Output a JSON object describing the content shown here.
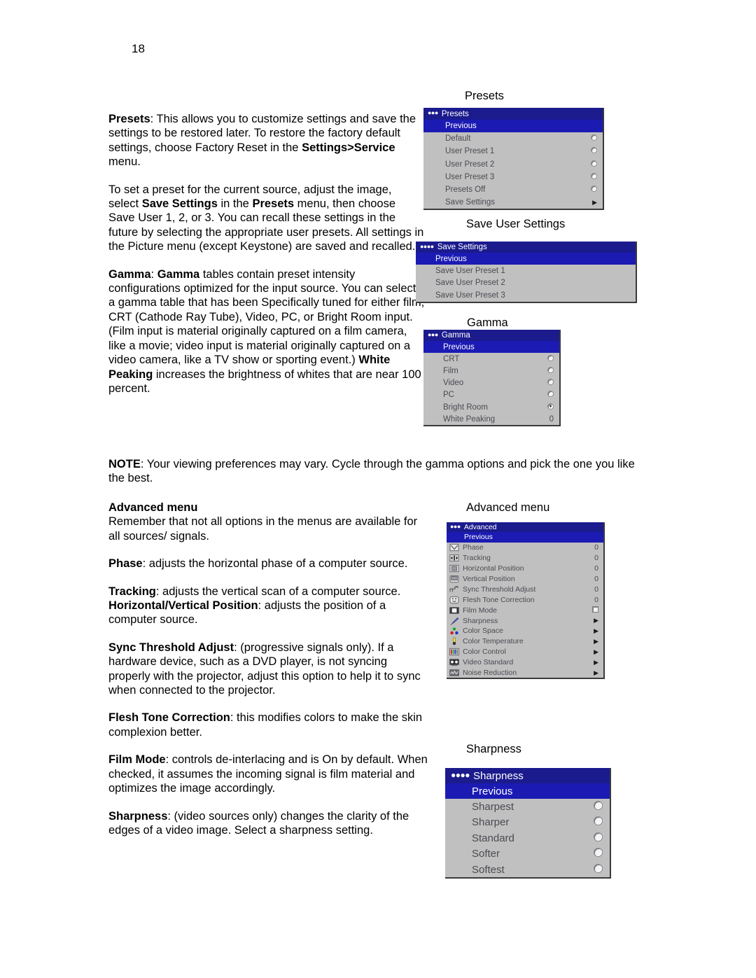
{
  "page": {
    "number": "18"
  },
  "body": {
    "p_presets": "Presets: This allows you to customize settings and save the settings to be restored later. To restore the factory default settings, choose Factory Reset in the Settings>Service menu.",
    "p_preset_howto": "To set a preset for the current source, adjust the image, select Save Settings in the Presets menu, then choose Save User 1, 2, or 3. You can recall these settings in the future by selecting the appropriate user presets. All settings in the Picture menu (except Keystone) are saved and recalled.",
    "p_gamma": "Gamma: Gamma tables contain preset intensity configurations optimized for the input source. You can select a gamma table that has been Specifically tuned for either film, CRT (Cathode Ray Tube), Video, PC, or Bright Room input. (Film input is material originally captured on a film camera, like a movie; video input is material originally captured on a video camera, like a TV show or sporting event.) White Peaking increases the brightness of whites that are near 100 percent.",
    "p_note": "NOTE: Your viewing preferences may vary. Cycle through the gamma options and pick the one you like the best.",
    "h_advanced": "Advanced menu",
    "p_advanced": "Remember that not all options in the menus are available for all sources/ signals.",
    "p_phase": "Phase: adjusts the horizontal phase of a computer source.",
    "p_tracking": "Tracking: adjusts the vertical scan of a computer source. Horizontal/Vertical Position: adjusts the position of a computer source.",
    "p_sync": "Sync Threshold Adjust: (progressive signals only). If a hardware device, such as a DVD player, is not syncing properly with the projector, adjust this option to help it to sync when connected to the projector.",
    "p_flesh": "Flesh Tone Correction: this modifies colors to make the skin complexion better.",
    "p_film": "Film Mode: controls de-interlacing and is On by default. When checked, it assumes the incoming signal is film material and optimizes the image accordingly.",
    "p_sharpness": "Sharpness: (video sources only) changes the clarity of the edges of a video image. Select a sharpness setting."
  },
  "captions": {
    "presets": "Presets",
    "save_user_settings": "Save User Settings",
    "gamma": "Gamma",
    "advanced": "Advanced menu",
    "sharpness": "Sharpness"
  },
  "colors": {
    "menu_header": "#1b1b8e",
    "menu_highlight": "#1b1bb4",
    "menu_background": "#c0c0c0",
    "menu_text": "#4a4a52",
    "menu_header_text": "#ffffff"
  },
  "menus": {
    "presets": {
      "dots": "●●●",
      "title": "Presets",
      "previous": "Previous",
      "items": [
        {
          "label": "Default",
          "control": "radio",
          "selected": false
        },
        {
          "label": "User Preset 1",
          "control": "radio",
          "selected": false
        },
        {
          "label": "User Preset 2",
          "control": "radio",
          "selected": false
        },
        {
          "label": "User Preset 3",
          "control": "radio",
          "selected": false
        },
        {
          "label": "Presets Off",
          "control": "radio",
          "selected": false
        },
        {
          "label": "Save Settings",
          "control": "arrow",
          "value": "▶"
        }
      ]
    },
    "save_settings": {
      "dots": "●●●●",
      "title": "Save Settings",
      "previous": "Previous",
      "items": [
        {
          "label": "Save User Preset 1",
          "control": "none"
        },
        {
          "label": "Save User Preset 2",
          "control": "none"
        },
        {
          "label": "Save User Preset 3",
          "control": "none"
        }
      ]
    },
    "gamma": {
      "dots": "●●●",
      "title": "Gamma",
      "previous": "Previous",
      "items": [
        {
          "label": "CRT",
          "control": "radio",
          "selected": false
        },
        {
          "label": "Film",
          "control": "radio",
          "selected": false
        },
        {
          "label": "Video",
          "control": "radio",
          "selected": false
        },
        {
          "label": "PC",
          "control": "radio",
          "selected": false
        },
        {
          "label": "Bright Room",
          "control": "radio",
          "selected": true
        },
        {
          "label": "White Peaking",
          "control": "value",
          "value": "0"
        }
      ]
    },
    "advanced": {
      "dots": "●●●",
      "title": "Advanced",
      "previous": "Previous",
      "items": [
        {
          "label": "Phase",
          "icon": "phase-icon",
          "control": "value",
          "value": "0"
        },
        {
          "label": "Tracking",
          "icon": "tracking-icon",
          "control": "value",
          "value": "0"
        },
        {
          "label": "Horizontal Position",
          "icon": "horizontal-position-icon",
          "control": "value",
          "value": "0"
        },
        {
          "label": "Vertical Position",
          "icon": "vertical-position-icon",
          "control": "value",
          "value": "0"
        },
        {
          "label": "Sync Threshold Adjust",
          "icon": "sync-threshold-icon",
          "control": "value",
          "value": "0"
        },
        {
          "label": "Flesh Tone Correction",
          "icon": "flesh-tone-icon",
          "control": "value",
          "value": "0"
        },
        {
          "label": "Film Mode",
          "icon": "film-mode-icon",
          "control": "checkbox",
          "checked": false
        },
        {
          "label": "Sharpness",
          "icon": "sharpness-brush-icon",
          "control": "arrow",
          "value": "▶"
        },
        {
          "label": "Color Space",
          "icon": "color-space-icon",
          "control": "arrow",
          "value": "▶"
        },
        {
          "label": "Color Temperature",
          "icon": "color-temperature-icon",
          "control": "arrow",
          "value": "▶"
        },
        {
          "label": "Color Control",
          "icon": "color-control-icon",
          "control": "arrow",
          "value": "▶"
        },
        {
          "label": "Video Standard",
          "icon": "video-standard-icon",
          "control": "arrow",
          "value": "▶"
        },
        {
          "label": "Noise Reduction",
          "icon": "noise-reduction-icon",
          "control": "arrow",
          "value": "▶"
        }
      ]
    },
    "sharpness": {
      "dots": "●●●●",
      "title": "Sharpness",
      "previous": "Previous",
      "items": [
        {
          "label": "Sharpest",
          "control": "radio",
          "selected": false
        },
        {
          "label": "Sharper",
          "control": "radio",
          "selected": false
        },
        {
          "label": "Standard",
          "control": "radio",
          "selected": false
        },
        {
          "label": "Softer",
          "control": "radio",
          "selected": false
        },
        {
          "label": "Softest",
          "control": "radio",
          "selected": false
        }
      ]
    }
  }
}
